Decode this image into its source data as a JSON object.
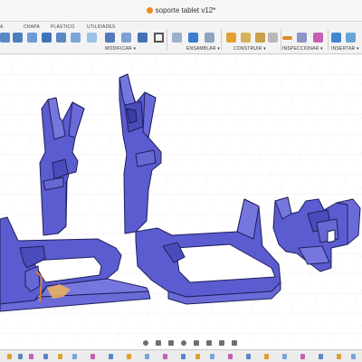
{
  "window": {
    "title": "soporte tablet v12*"
  },
  "toolbar": {
    "tabs": [
      "A",
      "CHAPA",
      "PLÁSTICO",
      "UTILIDADES"
    ],
    "groups": [
      "MODIFICAR ▾",
      "ENSAMBLAR ▾",
      "CONSTRUIR ▾",
      "INSPECCIONAR ▾",
      "INSERTAR ▾"
    ]
  },
  "icons": {
    "document": "document-icon",
    "move": "move-icon",
    "joint": "joint-icon",
    "plane": "construct-plane-icon",
    "measure": "measure-icon",
    "insert": "insert-image-icon",
    "orbit": "orbit-icon",
    "pan": "pan-icon",
    "zoom": "zoom-icon",
    "display": "display-settings-icon",
    "grid": "grid-icon"
  },
  "colors": {
    "model_fill": "#5b5ccf",
    "model_edge": "#1f1f5c",
    "accent_orange": "#f28a1e",
    "accent_blue": "#1a6fc4"
  }
}
